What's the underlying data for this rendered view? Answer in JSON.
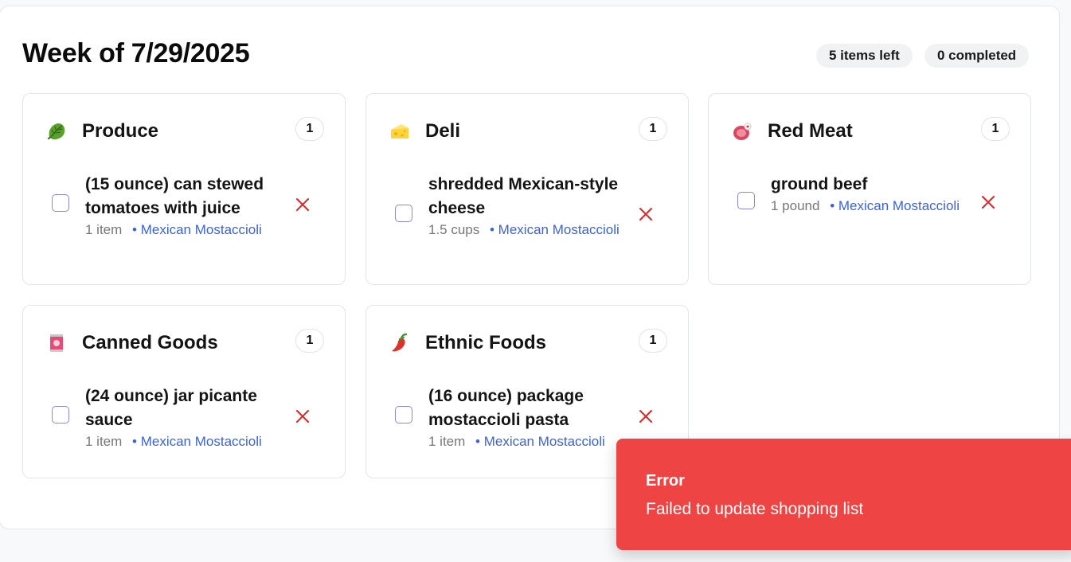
{
  "header": {
    "title": "Week of 7/29/2025",
    "items_left": "5 items left",
    "completed": "0 completed"
  },
  "categories": [
    {
      "name": "Produce",
      "icon": "leafy-greens-icon",
      "count": "1",
      "item": {
        "name": "(15 ounce) can stewed tomatoes with juice",
        "quantity": "1 item",
        "recipe": "• Mexican Mostaccioli",
        "checked": false
      }
    },
    {
      "name": "Deli",
      "icon": "cheese-icon",
      "count": "1",
      "item": {
        "name": "shredded Mexican-style cheese",
        "quantity": "1.5 cups",
        "recipe": "• Mexican Mostaccioli",
        "checked": false
      }
    },
    {
      "name": "Red Meat",
      "icon": "meat-icon",
      "count": "1",
      "item": {
        "name": "ground beef",
        "quantity": "1 pound",
        "recipe": "• Mexican Mostaccioli",
        "checked": false
      }
    },
    {
      "name": "Canned Goods",
      "icon": "canned-food-icon",
      "count": "1",
      "item": {
        "name": "(24 ounce) jar picante sauce",
        "quantity": "1 item",
        "recipe": "• Mexican Mostaccioli",
        "checked": false
      }
    },
    {
      "name": "Ethnic Foods",
      "icon": "chili-pepper-icon",
      "count": "1",
      "item": {
        "name": "(16 ounce) package mostaccioli pasta",
        "quantity": "1 item",
        "recipe": "• Mexican Mostaccioli",
        "checked": false
      }
    }
  ],
  "toast": {
    "title": "Error",
    "message": "Failed to update shopping list",
    "color": "#ef4444"
  },
  "colors": {
    "accent_link": "#3b63d8",
    "remove_x": "#dc2626",
    "checkbox_border": "#8b87d6"
  }
}
